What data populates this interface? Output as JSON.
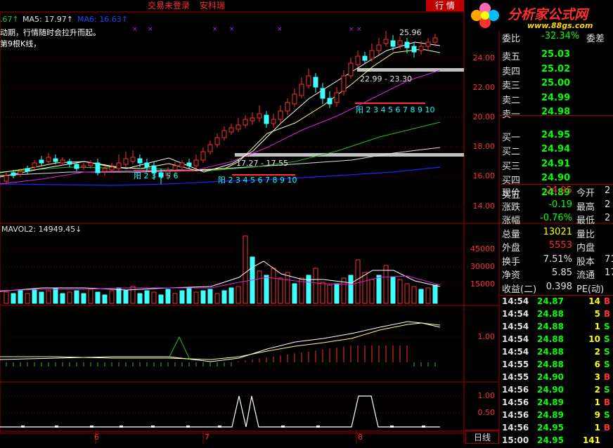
{
  "header": {
    "warning": "交易未登录",
    "stock_name": "安科瑞",
    "tab_label": "行 情",
    "ma_fragment": ".67↑",
    "ma5": "MA5: 17.97↑",
    "ma6": "MA6: 16.63↑",
    "note1": "动期，行情随时会拉升而起。",
    "note2": "第9根K线，"
  },
  "logo": {
    "brand": "分析家公式网",
    "url": "www.88gs.com"
  },
  "chart_data": {
    "type": "candlestick",
    "price_ticks": [
      "24.00",
      "22.00",
      "20.00",
      "18.00",
      "16.00",
      "14.00"
    ],
    "annotations": [
      "25.96",
      "22.99 - 23.30",
      "17.27 - 17.55",
      "阳 2 3 4 5 6 7 8 9 10",
      "阳 2 3 4 5 6 7 8 9 10",
      "阳 2 3 4 5 6"
    ],
    "volume_label": "MAVOL2: 14949.45↓",
    "volume_ticks": [
      "45000",
      "30000",
      "15000"
    ],
    "macd_ticks": [
      "1.00"
    ],
    "ind_ticks": [
      "1.00",
      "0.50"
    ],
    "x_ticks": [
      "6",
      "7",
      "8"
    ]
  },
  "orderbook": {
    "top_label": "委比",
    "top_value": "-32.34%",
    "top_label2": "委差",
    "sells": [
      {
        "label": "卖五",
        "price": "25.03"
      },
      {
        "label": "卖四",
        "price": "25.02"
      },
      {
        "label": "卖三",
        "price": "25.00"
      },
      {
        "label": "卖二",
        "price": "24.99"
      },
      {
        "label": "卖一",
        "price": "24.98"
      }
    ],
    "buys": [
      {
        "label": "买一",
        "price": "24.95"
      },
      {
        "label": "买二",
        "price": "24.94"
      },
      {
        "label": "买三",
        "price": "24.91"
      },
      {
        "label": "买四",
        "price": "24.90"
      },
      {
        "label": "买五",
        "price": "24.89"
      }
    ]
  },
  "stats": [
    {
      "l1": "现价",
      "v1": "24.95",
      "c1": "#ff3030",
      "l2": "今开",
      "v2": "2"
    },
    {
      "l1": "涨跌",
      "v1": "-0.19",
      "c1": "#00ff00",
      "l2": "最高",
      "v2": "2"
    },
    {
      "l1": "涨幅",
      "v1": "-0.76%",
      "c1": "#00ff00",
      "l2": "最低",
      "v2": "2"
    },
    {
      "l1": "总量",
      "v1": "13021",
      "c1": "#ffff00",
      "l2": "量比",
      "v2": ""
    },
    {
      "l1": "外盘",
      "v1": "5553",
      "c1": "#ff3030",
      "l2": "内盘",
      "v2": ""
    },
    {
      "l1": "换手",
      "v1": "7.51%",
      "c1": "#e0e0e0",
      "l2": "股本",
      "v2": "71"
    },
    {
      "l1": "净资",
      "v1": "5.85",
      "c1": "#e0e0e0",
      "l2": "流通",
      "v2": "17"
    },
    {
      "l1": "收益(二)",
      "v1": "0.398",
      "c1": "#e0e0e0",
      "l2": "PE(动)",
      "v2": ""
    }
  ],
  "trades": [
    {
      "time": "14:54",
      "price": "24.87",
      "vol": "14",
      "side": "B"
    },
    {
      "time": "14:54",
      "price": "24.88",
      "vol": "5",
      "side": "B"
    },
    {
      "time": "14:54",
      "price": "24.88",
      "vol": "1",
      "side": "S"
    },
    {
      "time": "14:54",
      "price": "24.88",
      "vol": "10",
      "side": "S"
    },
    {
      "time": "14:54",
      "price": "24.88",
      "vol": "2",
      "side": "S"
    },
    {
      "time": "14:55",
      "price": "24.88",
      "vol": "6",
      "side": "S"
    },
    {
      "time": "14:55",
      "price": "24.90",
      "vol": "3",
      "side": "B"
    },
    {
      "time": "14:56",
      "price": "24.90",
      "vol": "2",
      "side": "S"
    },
    {
      "time": "14:56",
      "price": "24.89",
      "vol": "1",
      "side": "B"
    },
    {
      "time": "14:56",
      "price": "24.89",
      "vol": "9",
      "side": "S"
    },
    {
      "time": "14:56",
      "price": "24.95",
      "vol": "1",
      "side": "B"
    },
    {
      "time": "15:00",
      "price": "24.95",
      "vol": "141",
      "side": ""
    }
  ],
  "bottom_tab": "日线"
}
